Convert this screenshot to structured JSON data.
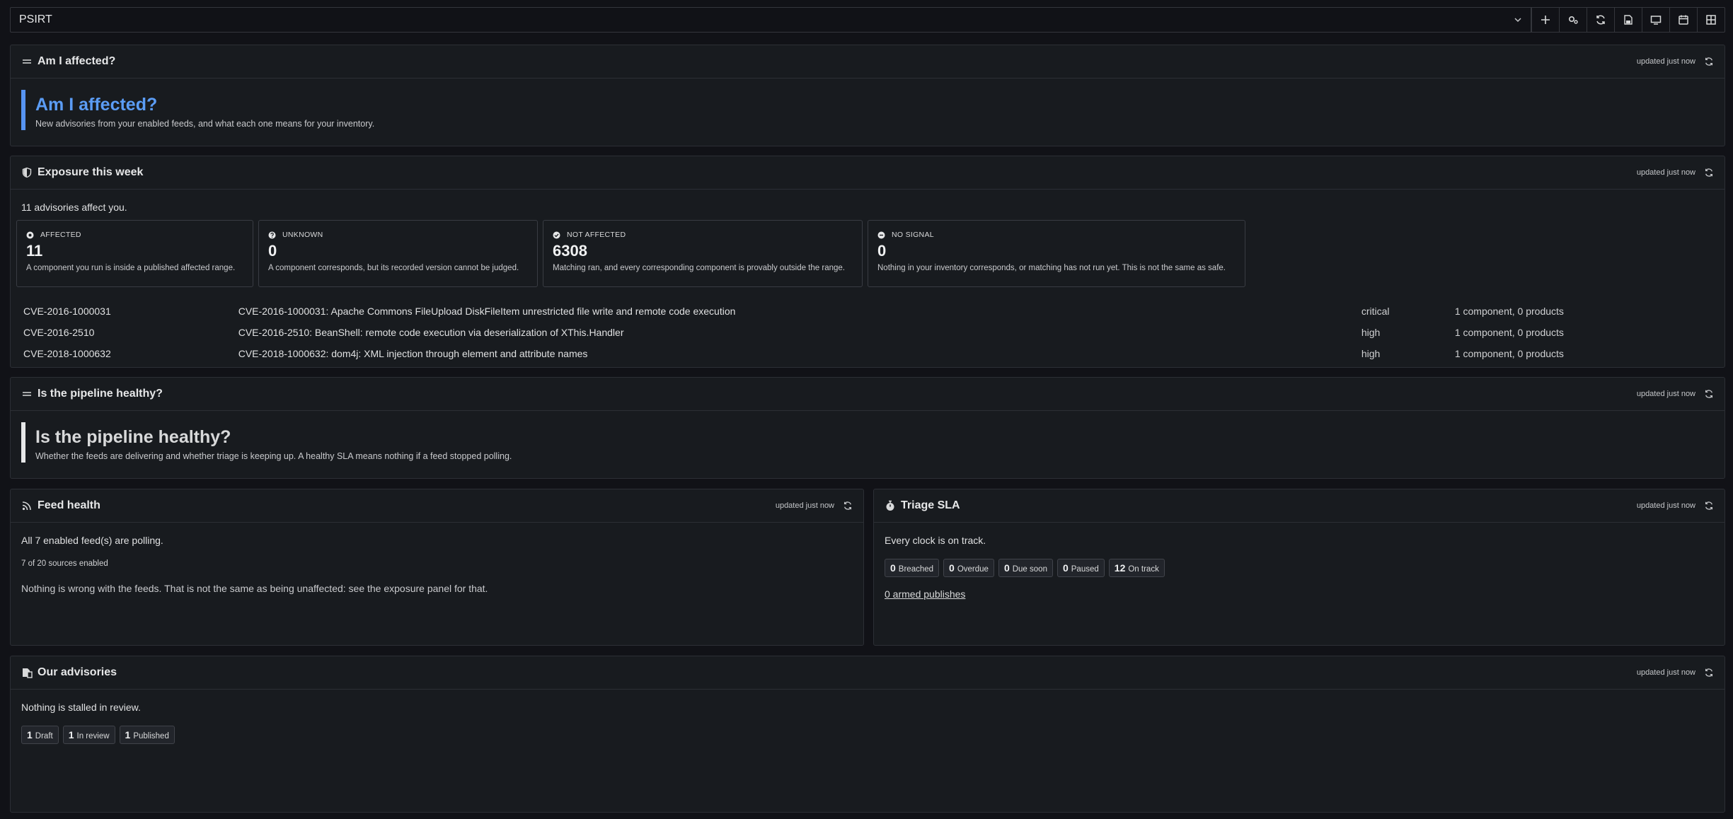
{
  "toolbar": {
    "dashboard_select": "PSIRT",
    "buttons": [
      "add-icon",
      "settings-icon",
      "refresh-icon",
      "save-icon",
      "tv-mode-icon",
      "calendar-icon",
      "grid-view-icon"
    ]
  },
  "panels": {
    "affected_text": {
      "title": "Am I affected?",
      "updated": "updated just now",
      "banner_title": "Am I affected?",
      "banner_subtitle": "New advisories from your enabled feeds, and what each one means for your inventory."
    },
    "exposure": {
      "title": "Exposure this week",
      "updated": "updated just now",
      "lead": "11 advisories affect you.",
      "cards": [
        {
          "label": "AFFECTED",
          "value": "11",
          "desc": "A component you run is inside a published affected range."
        },
        {
          "label": "UNKNOWN",
          "value": "0",
          "desc": "A component corresponds, but its recorded version cannot be judged."
        },
        {
          "label": "NOT AFFECTED",
          "value": "6308",
          "desc": "Matching ran, and every corresponding component is provably outside the range."
        },
        {
          "label": "NO SIGNAL",
          "value": "0",
          "desc": "Nothing in your inventory corresponds, or matching has not run yet. This is not the same as safe."
        }
      ],
      "rows": [
        {
          "id": "CVE-2016-1000031",
          "title": "CVE-2016-1000031: Apache Commons FileUpload DiskFileItem unrestricted file write and remote code execution",
          "severity": "critical",
          "scope": "1 component, 0 products"
        },
        {
          "id": "CVE-2016-2510",
          "title": "CVE-2016-2510: BeanShell: remote code execution via deserialization of XThis.Handler",
          "severity": "high",
          "scope": "1 component, 0 products"
        },
        {
          "id": "CVE-2018-1000632",
          "title": "CVE-2018-1000632: dom4j: XML injection through element and attribute names",
          "severity": "high",
          "scope": "1 component, 0 products"
        }
      ]
    },
    "pipeline_text": {
      "title": "Is the pipeline healthy?",
      "updated": "updated just now",
      "banner_title": "Is the pipeline healthy?",
      "banner_subtitle": "Whether the feeds are delivering and whether triage is keeping up. A healthy SLA means nothing if a feed stopped polling."
    },
    "feed_health": {
      "title": "Feed health",
      "updated": "updated just now",
      "lead": "All 7 enabled feed(s) are polling.",
      "sources": "7 of 20 sources enabled",
      "note": "Nothing is wrong with the feeds. That is not the same as being unaffected: see the exposure panel for that."
    },
    "triage_sla": {
      "title": "Triage SLA",
      "updated": "updated just now",
      "lead": "Every clock is on track.",
      "pills": [
        {
          "n": "0",
          "label": "Breached"
        },
        {
          "n": "0",
          "label": "Overdue"
        },
        {
          "n": "0",
          "label": "Due soon"
        },
        {
          "n": "0",
          "label": "Paused"
        },
        {
          "n": "12",
          "label": "On track"
        }
      ],
      "link": "0 armed publishes"
    },
    "advisories": {
      "title": "Our advisories",
      "updated": "updated just now",
      "lead": "Nothing is stalled in review.",
      "pills": [
        {
          "n": "1",
          "label": "Draft"
        },
        {
          "n": "1",
          "label": "In review"
        },
        {
          "n": "1",
          "label": "Published"
        }
      ]
    }
  },
  "colors": {
    "background": "#111217",
    "panel": "#181b1f",
    "accent_blue": "#5794f2"
  }
}
